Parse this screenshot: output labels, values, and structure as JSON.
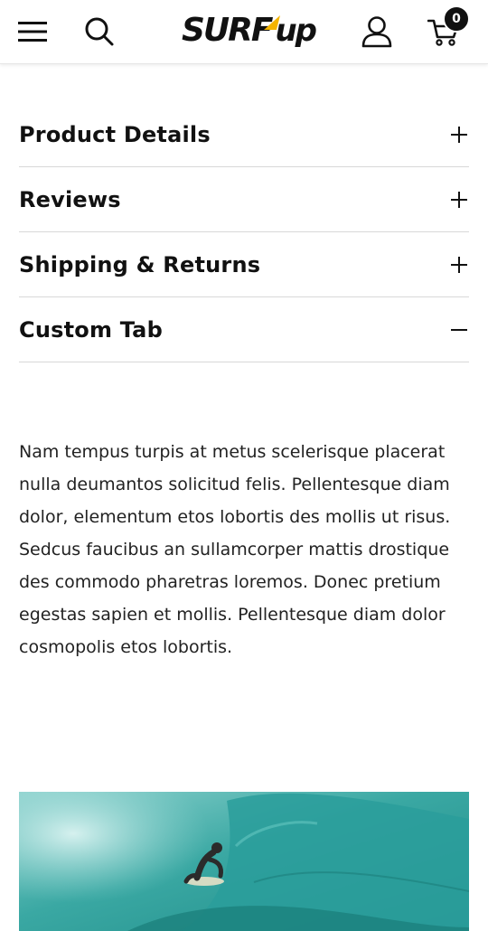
{
  "header": {
    "logo_text": "SURF",
    "logo_text_2": "up",
    "cart_count": "0",
    "icons": {
      "menu": "hamburger-menu-icon",
      "search": "search-icon",
      "account": "user-icon",
      "cart": "cart-icon"
    },
    "accent_color": "#f4b400"
  },
  "accordion": {
    "items": [
      {
        "title": "Product Details",
        "state": "collapsed",
        "icon": "plus-icon"
      },
      {
        "title": "Reviews",
        "state": "collapsed",
        "icon": "plus-icon"
      },
      {
        "title": "Shipping & Returns",
        "state": "collapsed",
        "icon": "plus-icon"
      },
      {
        "title": "Custom Tab",
        "state": "expanded",
        "icon": "minus-icon"
      }
    ]
  },
  "custom_tab": {
    "body": "Nam tempus turpis at metus scelerisque placerat nulla deumantos solicitud felis. Pellentesque diam dolor, elementum etos lobortis des mollis ut risus. Sedcus faucibus an sullamcorper mattis drostique des commodo pharetras loremos. Donec pretium egestas sapien et mollis. Pellentesque diam dolor cosmopolis etos lobortis."
  },
  "colors": {
    "wave": "#2a9e9b",
    "foam": "#c9ecea"
  }
}
